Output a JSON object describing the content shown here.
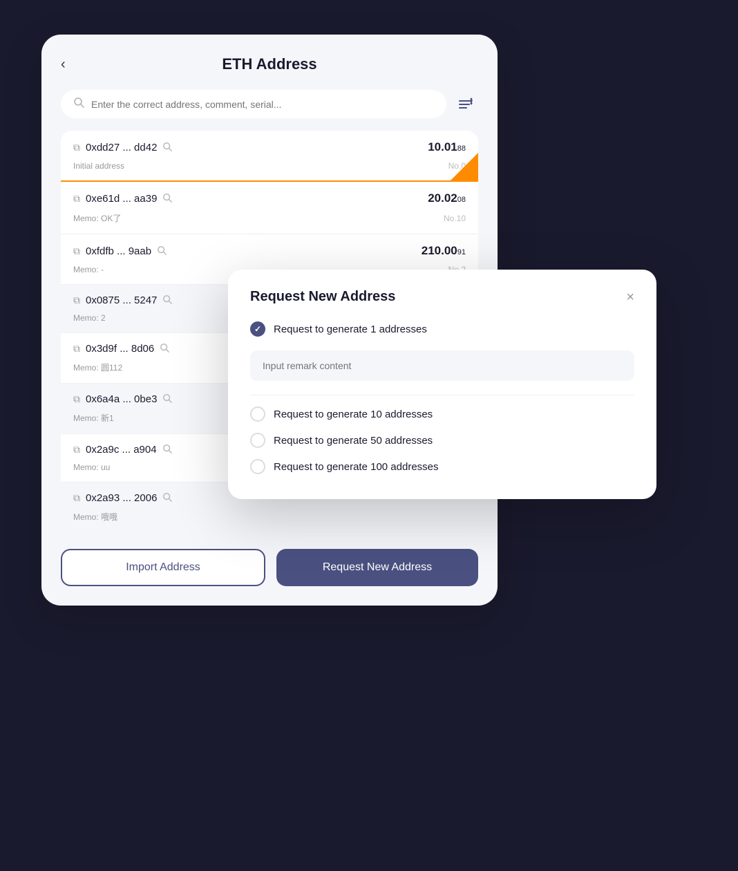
{
  "page": {
    "title": "ETH Address",
    "back_label": "‹",
    "search_placeholder": "Enter the correct address, comment, serial...",
    "addresses": [
      {
        "address": "0xdd27 ... dd42",
        "memo": "Initial address",
        "amount_int": "10.01",
        "amount_dec": "88",
        "no": "No.0",
        "first": true
      },
      {
        "address": "0xe61d ... aa39",
        "memo": "Memo: OK了",
        "amount_int": "20.02",
        "amount_dec": "08",
        "no": "No.10",
        "first": false
      },
      {
        "address": "0xfdfb ... 9aab",
        "memo": "Memo: -",
        "amount_int": "210.00",
        "amount_dec": "91",
        "no": "No.2",
        "first": false
      },
      {
        "address": "0x0875 ... 5247",
        "memo": "Memo: 2",
        "amount_int": "",
        "amount_dec": "",
        "no": "",
        "first": false
      },
      {
        "address": "0x3d9f ... 8d06",
        "memo": "Memo: 圆112",
        "amount_int": "",
        "amount_dec": "",
        "no": "",
        "first": false
      },
      {
        "address": "0x6a4a ... 0be3",
        "memo": "Memo: 新1",
        "amount_int": "",
        "amount_dec": "",
        "no": "",
        "first": false
      },
      {
        "address": "0x2a9c ... a904",
        "memo": "Memo: uu",
        "amount_int": "",
        "amount_dec": "",
        "no": "",
        "first": false
      },
      {
        "address": "0x2a93 ... 2006",
        "memo": "Memo: 哦哦",
        "amount_int": "",
        "amount_dec": "",
        "no": "",
        "first": false
      }
    ],
    "btn_import": "Import Address",
    "btn_request": "Request New Address"
  },
  "modal": {
    "title": "Request New Address",
    "close_label": "×",
    "remark_placeholder": "Input remark content",
    "options": [
      {
        "label": "Request to generate 1 addresses",
        "checked": true
      },
      {
        "label": "Request to generate 10 addresses",
        "checked": false
      },
      {
        "label": "Request to generate 50 addresses",
        "checked": false
      },
      {
        "label": "Request to generate 100 addresses",
        "checked": false
      }
    ]
  }
}
